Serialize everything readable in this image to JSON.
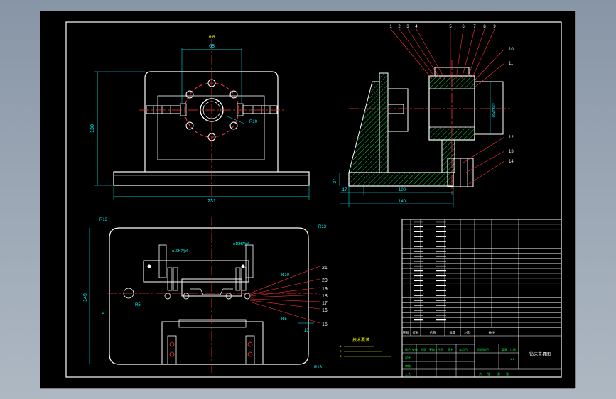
{
  "colors": {
    "background": "#000000",
    "border": "#ffffff",
    "dimension": "#00ffff",
    "part": "#ffffff",
    "centerline": "#ff3333",
    "hatch": "#00cc44",
    "leader": "#ff3333",
    "label": "#ffffff",
    "title_text": "#00ff44",
    "annotation": "#ffff00"
  },
  "front_view": {
    "top_dim": "68",
    "mark_a": "A-A",
    "height_dim": "138",
    "width_dim": "231",
    "radius_callout": "R10"
  },
  "side_view": {
    "callouts_top": [
      "1",
      "2",
      "3",
      "4",
      "5",
      "6",
      "7",
      "8",
      "9"
    ],
    "callouts_right": [
      "10",
      "11",
      "12",
      "13",
      "14"
    ],
    "fit_label": "φ52H8/f7",
    "height_dim": "37",
    "left_dim": "17",
    "base_dim": "100",
    "total_dim": "140"
  },
  "plan_view": {
    "corner_tl": "R13",
    "corner_tr": "R13",
    "corner_br": "R13",
    "fit_left": "φ10H7/js6",
    "fit_right": "φ10H7/js6",
    "height_dim": "149",
    "left_mark": "4",
    "slot_label": "R5",
    "radius_label": "R10",
    "r5": "R5",
    "dim_13": "13",
    "callouts": [
      "21",
      "20",
      "19",
      "18",
      "17",
      "16",
      "15"
    ]
  },
  "tech_notes": {
    "title": "技术要求",
    "lines": [
      "1.",
      "2.",
      "3."
    ]
  },
  "title_block": {
    "drawing_title": "钻床夹具图",
    "header_row": [
      "序号",
      "代号",
      "名称",
      "数量",
      "材料",
      "备注"
    ],
    "sign_row": [
      "标记",
      "处数",
      "分区",
      "更改文件号",
      "签名",
      "年月日"
    ],
    "role_labels": [
      "设计",
      "审核",
      "工艺"
    ],
    "stage_label": "阶段标记",
    "weight_label": "重量",
    "scale_label": "比例",
    "scale_value": "1:1",
    "sheet_labels": [
      "共",
      "张",
      "第",
      "张"
    ]
  }
}
